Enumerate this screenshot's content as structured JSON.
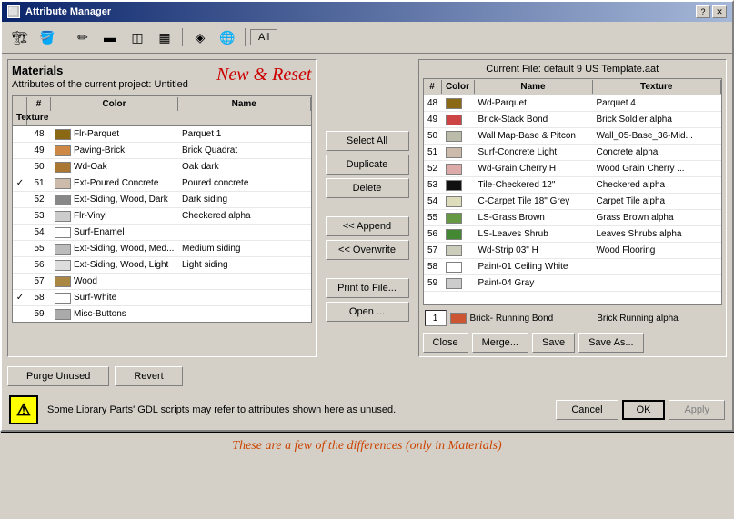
{
  "window": {
    "title": "Attribute Manager",
    "toolbar_buttons": [
      {
        "name": "materials-icon",
        "icon": "🏗",
        "label": "Materials"
      },
      {
        "name": "fill-icon",
        "icon": "🪣",
        "label": "Fill"
      },
      {
        "name": "pen-icon",
        "icon": "✏",
        "label": "Pen"
      },
      {
        "name": "line-icon",
        "icon": "—",
        "label": "Line"
      },
      {
        "name": "surface-icon",
        "icon": "◫",
        "label": "Surface"
      },
      {
        "name": "composite-icon",
        "icon": "▦",
        "label": "Composite"
      },
      {
        "name": "zone-icon",
        "icon": "◈",
        "label": "Zone"
      },
      {
        "name": "world-icon",
        "icon": "🌐",
        "label": "World"
      }
    ],
    "all_button": "All"
  },
  "left_panel": {
    "title": "Materials",
    "new_reset_label": "New & Reset",
    "subtitle": "Attributes of the current project: Untitled",
    "columns": [
      "#",
      "Color",
      "Name",
      "Texture"
    ],
    "rows": [
      {
        "num": "48",
        "color": "#8B6914",
        "name": "Flr-Parquet",
        "texture": "Parquet 1",
        "checked": false
      },
      {
        "num": "49",
        "color": "#cc8844",
        "name": "Paving-Brick",
        "texture": "Brick Quadrat",
        "checked": false
      },
      {
        "num": "50",
        "color": "#aa7733",
        "name": "Wd-Oak",
        "texture": "Oak dark",
        "checked": false
      },
      {
        "num": "51",
        "color": "#ccbbaa",
        "name": "Ext-Poured Concrete",
        "texture": "Poured concrete",
        "checked": true
      },
      {
        "num": "52",
        "color": "#888888",
        "name": "Ext-Siding, Wood, Dark",
        "texture": "Dark siding",
        "checked": false
      },
      {
        "num": "53",
        "color": "#cccccc",
        "name": "Flr-Vinyl",
        "texture": "Checkered alpha",
        "checked": false
      },
      {
        "num": "54",
        "color": "#ffffff",
        "name": "Surf-Enamel",
        "texture": "",
        "checked": false
      },
      {
        "num": "55",
        "color": "#bbbbbb",
        "name": "Ext-Siding, Wood, Med...",
        "texture": "Medium siding",
        "checked": false
      },
      {
        "num": "56",
        "color": "#dddddd",
        "name": "Ext-Siding, Wood, Light",
        "texture": "Light siding",
        "checked": false
      },
      {
        "num": "57",
        "color": "#aa8844",
        "name": "Wood",
        "texture": "",
        "checked": false
      },
      {
        "num": "58",
        "color": "#ffffff",
        "name": "Surf-White",
        "texture": "",
        "checked": true
      },
      {
        "num": "59",
        "color": "#aaaaaa",
        "name": "Misc-Buttons",
        "texture": "",
        "checked": false
      }
    ]
  },
  "middle_buttons": {
    "select_all": "Select All",
    "duplicate": "Duplicate",
    "delete": "Delete",
    "append": "<< Append",
    "overwrite": "<< Overwrite",
    "print": "Print to File...",
    "open": "Open ..."
  },
  "right_panel": {
    "title": "Current File: default 9 US Template.aat",
    "columns": [
      "#",
      "Color",
      "Name",
      "Texture"
    ],
    "rows": [
      {
        "num": "48",
        "color": "#8B6914",
        "name": "Wd-Parquet",
        "texture": "Parquet 4"
      },
      {
        "num": "49",
        "color": "#cc4444",
        "name": "Brick-Stack Bond",
        "texture": "Brick Soldier alpha"
      },
      {
        "num": "50",
        "color": "#bbbbaa",
        "name": "Wall Map-Base & Pitcon",
        "texture": "Wall_05-Base_36-Mid..."
      },
      {
        "num": "51",
        "color": "#ccbbaa",
        "name": "Surf-Concrete Light",
        "texture": "Concrete alpha"
      },
      {
        "num": "52",
        "color": "#ddaaaa",
        "name": "Wd-Grain Cherry H",
        "texture": "Wood Grain Cherry ..."
      },
      {
        "num": "53",
        "color": "#111111",
        "name": "Tile-Checkered 12\"",
        "texture": "Checkered alpha"
      },
      {
        "num": "54",
        "color": "#ddddbb",
        "name": "C-Carpet Tile 18\" Grey",
        "texture": "Carpet Tile alpha"
      },
      {
        "num": "55",
        "color": "#669944",
        "name": "LS-Grass Brown",
        "texture": "Grass Brown alpha"
      },
      {
        "num": "56",
        "color": "#448833",
        "name": "LS-Leaves Shrub",
        "texture": "Leaves Shrubs alpha"
      },
      {
        "num": "57",
        "color": "#ccccbb",
        "name": "Wd-Strip 03\" H",
        "texture": "Wood Flooring"
      },
      {
        "num": "58",
        "color": "#ffffff",
        "name": "Paint-01 Ceiling White",
        "texture": ""
      },
      {
        "num": "59",
        "color": "#cccccc",
        "name": "Paint-04 Gray",
        "texture": ""
      }
    ],
    "bottom_row": {
      "page": "1",
      "color": "#cc5533",
      "name": "Brick- Running Bond",
      "texture": "Brick Running alpha"
    },
    "action_buttons": {
      "close": "Close",
      "merge": "Merge...",
      "save": "Save",
      "save_as": "Save As..."
    }
  },
  "bottom": {
    "purge": "Purge Unused",
    "revert": "Revert",
    "warning": "Some Library Parts' GDL scripts may refer to attributes shown here as unused.",
    "cancel": "Cancel",
    "ok": "OK",
    "apply": "Apply"
  },
  "footer_note": "These are a few of the differences (only in Materials)"
}
